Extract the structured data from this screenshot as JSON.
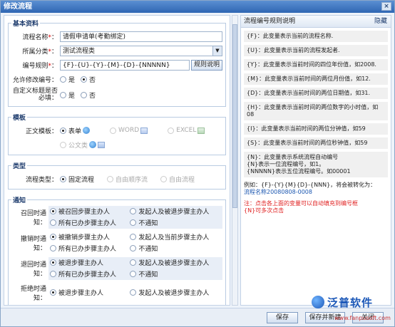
{
  "window": {
    "title": "修改流程",
    "close_label": "×"
  },
  "basic": {
    "legend": "基本资料",
    "name_label": "流程名称",
    "name_value": "请假申请单(考勤绑定)",
    "category_label": "所属分类",
    "category_value": "测试流程类",
    "code_label": "编号规则",
    "code_value": "{F}-{U}-{Y}-{M}-{D}-{NNNNN}",
    "code_button": "规则说明",
    "allow_label": "允许修改编号",
    "allow_yes": "是",
    "allow_no": "否",
    "custom_label": "自定义标题是否必填",
    "custom_yes": "是",
    "custom_no": "否",
    "required_mark": "*"
  },
  "template": {
    "legend": "模板",
    "label": "正文模板",
    "opt_form": "表单",
    "opt_word": "WORD",
    "opt_excel": "EXCEL",
    "opt_doc": "公文类"
  },
  "type": {
    "legend": "类型",
    "label": "流程类型",
    "opt_fixed": "固定流程",
    "opt_free_seq": "自由顺序流",
    "opt_free": "自由流程"
  },
  "notify": {
    "legend": "通知",
    "rows": [
      {
        "label": "召回时通知",
        "a": "被召回步骤主办人",
        "b": "发起人及被退步骤主办人",
        "c": "所有已办步骤主办人",
        "d": "不通知"
      },
      {
        "label": "撤销时通知",
        "a": "被撤销步骤主办人",
        "b": "发起人及当前步骤主办人",
        "c": "所有已办步骤主办人",
        "d": "不通知"
      },
      {
        "label": "退回时通知",
        "a": "被退步骤主办人",
        "b": "发起人及被退步骤主办人",
        "c": "所有已办步骤主办人",
        "d": "不通知"
      },
      {
        "label": "拒绝时通知",
        "a": "被退步骤主办人",
        "b": "发起人及被退步骤主办人"
      }
    ]
  },
  "help": {
    "title": "流程编号规则说明",
    "hide": "隐藏",
    "items": [
      "{F}：此变量表示当前的流程名称.",
      "{U}：此变量表示当前的流程发起者.",
      "{Y}：此变量表示当前时间的四位年份值，如2008.",
      "{M}：此变量表示当前时间的两位月份值，如12.",
      "{D}：此变量表示当前时间的两位日期值，如31.",
      "{H}：此变量表示当前时间的两位数字的小时值，如08",
      "{I}：此变量表示当前时间的两位分钟值，如59",
      "{S}：此变量表示当前时间的两位秒钟值，如59",
      "{N}：此变量表示系统流程自动编号\n    {N}表示一位流程编号，如1。\n    {NNNNN}表示五位流程编号。如00001"
    ],
    "example": "例如：{F}-{Y}{M}{D}-{NNN}，将会被转化为：",
    "example_result": "流程名称20080808-0008",
    "note": "注：点击各上面的变量可以自动填充到编号框\n{N}可多次点击"
  },
  "footer": {
    "save": "保存",
    "save_new": "保存并新建",
    "close": "关闭"
  },
  "brand": {
    "logo_text": "泛普软件",
    "watermark": "www.fanpusoft.com"
  }
}
